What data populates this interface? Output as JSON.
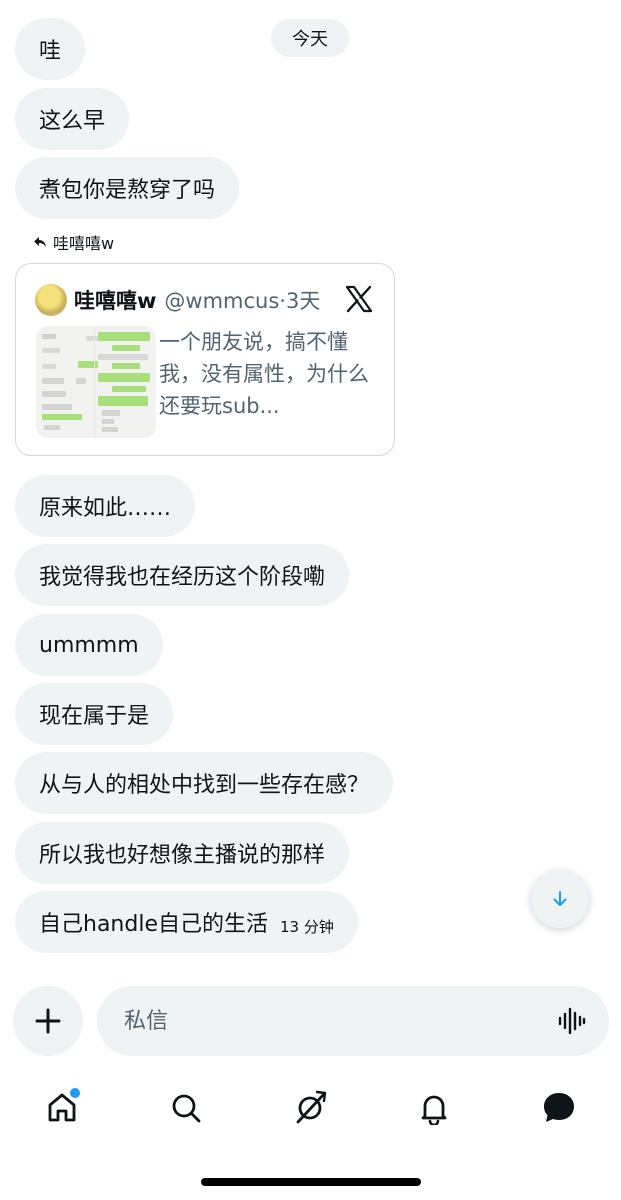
{
  "date_divider": "今天",
  "messages_top": [
    "哇",
    "这么早",
    "煮包你是熬穿了吗"
  ],
  "reply_to": "哇嘻嘻w",
  "quote": {
    "name": "哇嘻嘻w",
    "handle": "@wmmcus",
    "age": "3天",
    "text": "一个朋友说，搞不懂我，没有属性，为什么还要玩sub..."
  },
  "messages_bottom": [
    "原来如此……",
    "我觉得我也在经历这个阶段嘞",
    "ummmm",
    "现在属于是",
    "从与人的相处中找到一些存在感？",
    "所以我也好想像主播说的那样",
    "自己handle自己的生活"
  ],
  "last_timestamp": "13 分钟",
  "composer": {
    "placeholder": "私信"
  },
  "nav": {
    "items": [
      "home-icon",
      "search-icon",
      "grok-icon",
      "notifications-icon",
      "messages-icon"
    ],
    "home_badge": true
  },
  "colors": {
    "accent": "#1d9bf0",
    "bubble": "#eff3f4",
    "text": "#0f1419",
    "muted": "#536471"
  }
}
